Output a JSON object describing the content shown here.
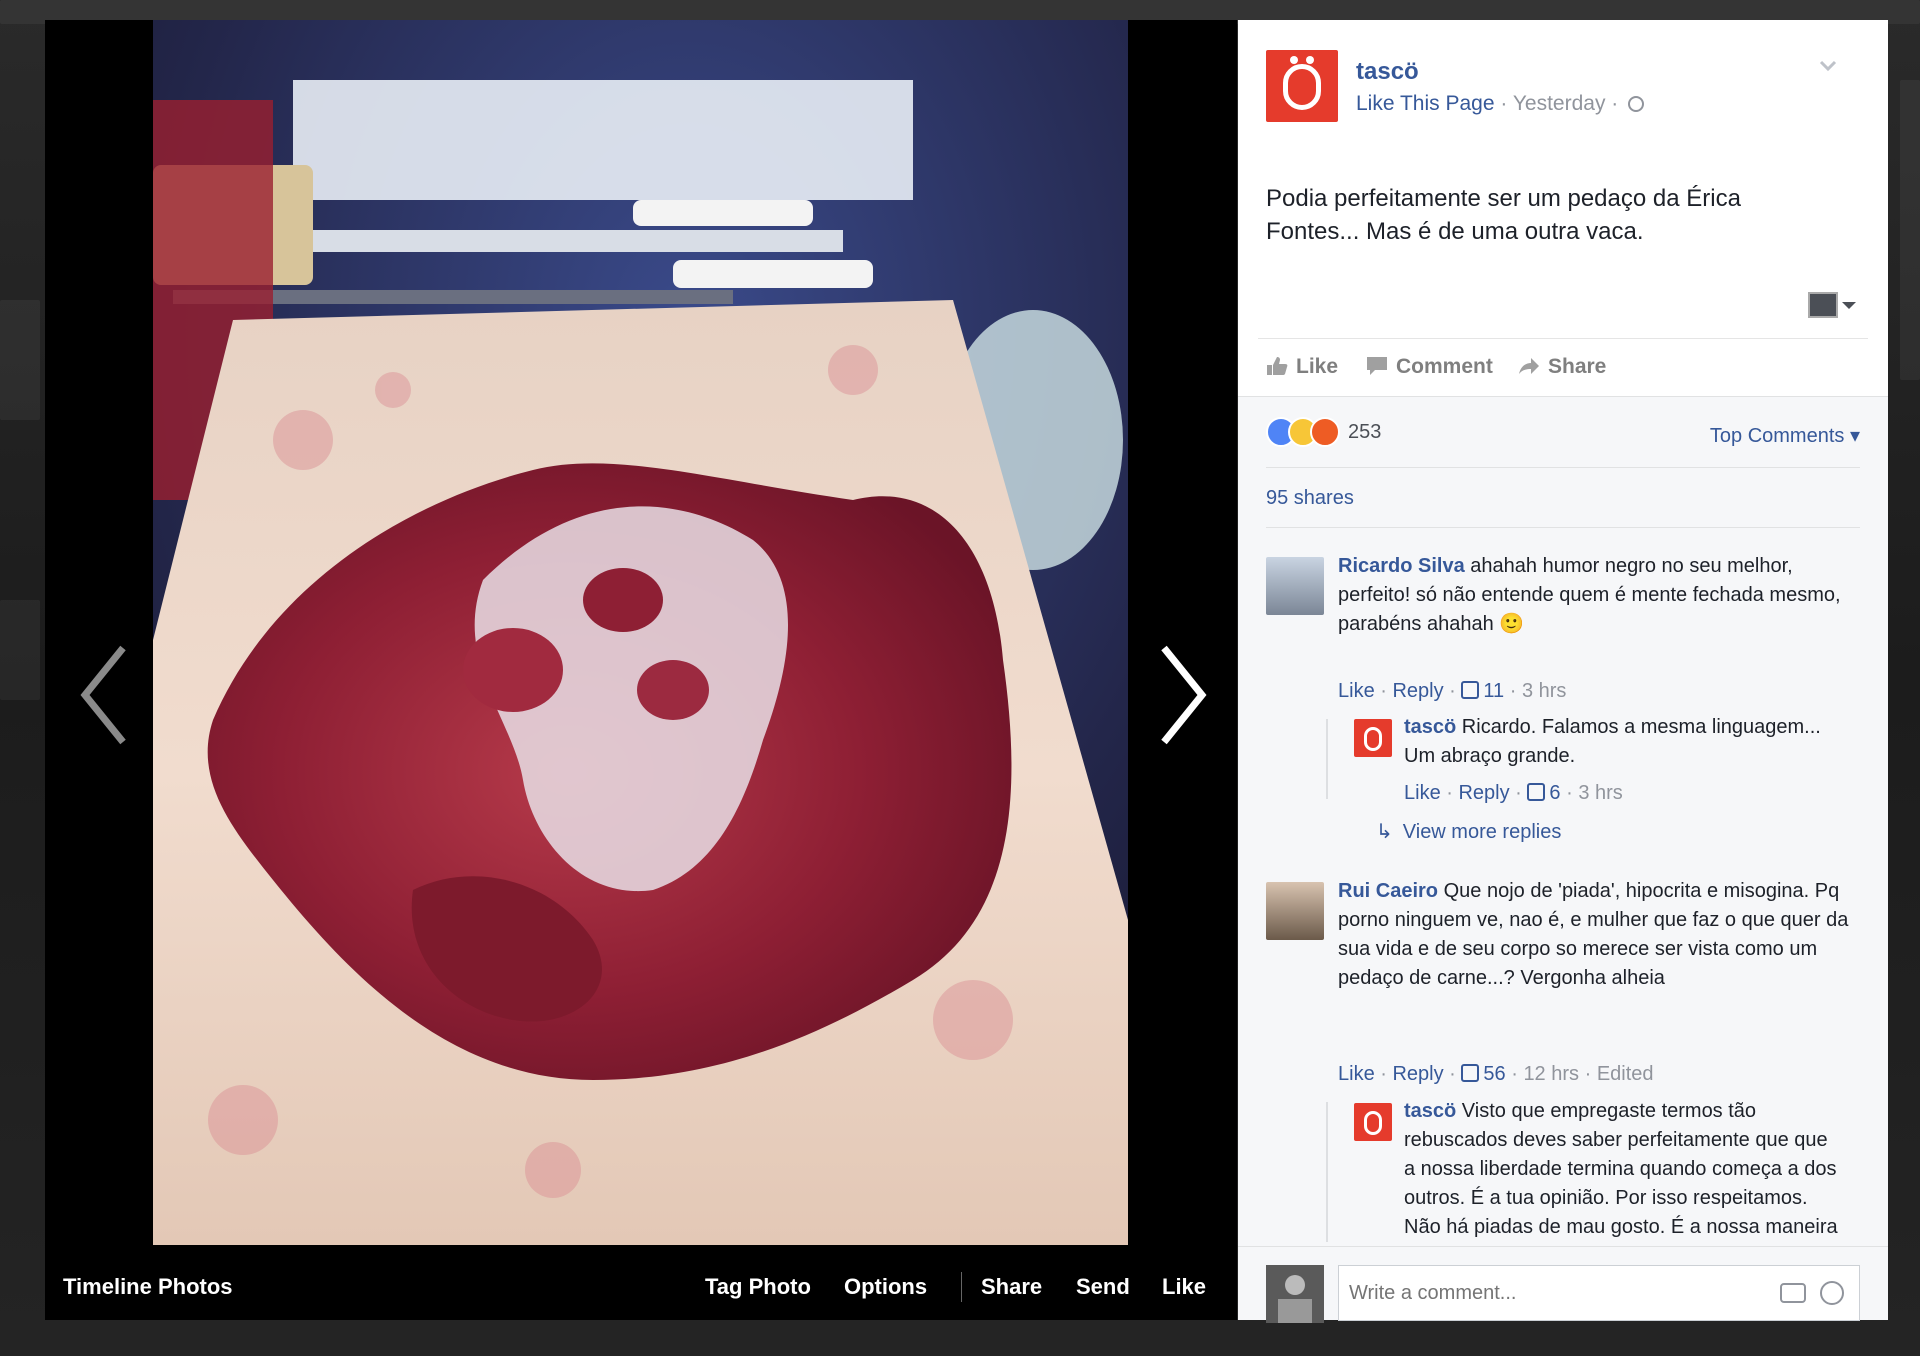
{
  "theater": {
    "album_label": "Timeline Photos",
    "actions": {
      "tag": "Tag Photo",
      "options": "Options",
      "share": "Share",
      "send": "Send",
      "like": "Like"
    }
  },
  "post": {
    "page_name": "tascö",
    "like_page": "Like This Page",
    "meta_sep1": " · ",
    "time": "Yesterday",
    "meta_sep2": " · ",
    "text": "Podia perfeitamente ser um pedaço da Érica Fontes... Mas é de uma outra vaca.",
    "actions": {
      "like": "Like",
      "comment": "Comment",
      "share": "Share"
    },
    "reaction_count": "253",
    "top_comments": "Top Comments ▾",
    "shares": "95 shares"
  },
  "comments": [
    {
      "author": "Ricardo Silva",
      "text": " ahahah humor negro no seu melhor, perfeito! só não entende quem é mente fechada mesmo, parabéns ahahah 🙂",
      "like": "Like",
      "reply": "Reply",
      "likes": "11",
      "time": "3 hrs",
      "edited": "",
      "reply_item": {
        "author": "tascö",
        "text": " Ricardo. Falamos a mesma linguagem... Um abraço grande.",
        "like": "Like",
        "reply": "Reply",
        "likes": "6",
        "time": "3 hrs"
      },
      "view_more": "View more replies"
    },
    {
      "author": "Rui Caeiro",
      "text": " Que nojo de 'piada', hipocrita e misogina. Pq porno ninguem ve, nao é, e mulher que faz o que quer da sua vida e de seu corpo so merece ser vista como um pedaço de carne...? Vergonha alheia",
      "like": "Like",
      "reply": "Reply",
      "likes": "56",
      "time": "12 hrs",
      "edited": "Edited",
      "reply_item": {
        "author": "tascö",
        "text": " Visto que empregaste termos tão rebuscados deves saber perfeitamente que que a nossa liberdade termina quando começa a dos outros. É a tua opinião. Por isso respeitamos. Não há piadas de mau gosto. É a nossa maneira de ver o humor. E por esses adoramos"
      }
    }
  ],
  "composer": {
    "placeholder": "Write a comment..."
  },
  "colors": {
    "brand": "#e53b2c",
    "link": "#365899",
    "meta": "#90949c",
    "panel_bg": "#f6f7f9"
  },
  "icons": [
    "chevron-left-icon",
    "chevron-right-icon",
    "globe-icon",
    "chevron-down-icon",
    "thumbs-up-icon",
    "comment-icon",
    "share-arrow-icon",
    "camera-icon",
    "emoji-icon",
    "reply-arrow-icon"
  ]
}
